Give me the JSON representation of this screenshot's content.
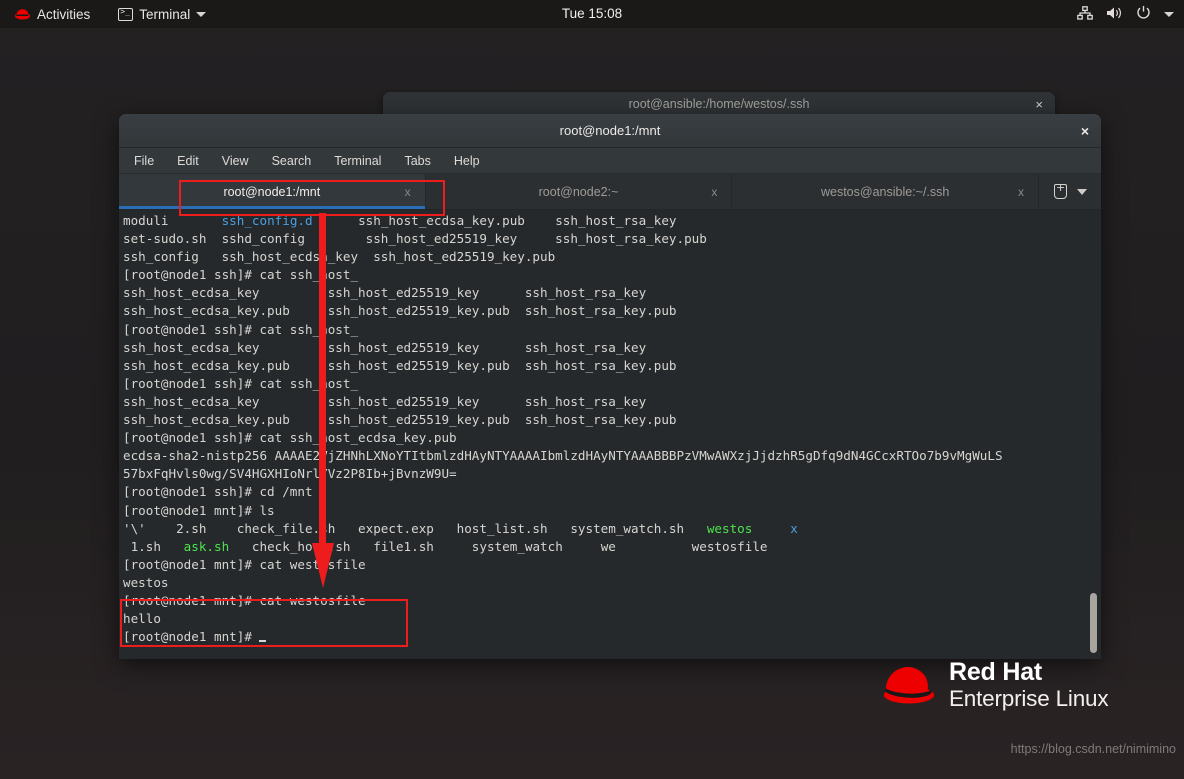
{
  "topbar": {
    "activities": "Activities",
    "app_menu": "Terminal",
    "clock": "Tue 15:08",
    "icons": [
      "network-icon",
      "volume-icon",
      "power-icon",
      "chevron-down-icon"
    ]
  },
  "background_window": {
    "title": "root@ansible:/home/westos/.ssh",
    "close": "×"
  },
  "window": {
    "title": "root@node1:/mnt",
    "close": "×"
  },
  "menubar": {
    "items": [
      "File",
      "Edit",
      "View",
      "Search",
      "Terminal",
      "Tabs",
      "Help"
    ]
  },
  "tabs": [
    {
      "label": "root@node1:/mnt",
      "close": "x",
      "active": true
    },
    {
      "label": "root@node2:~",
      "close": "x",
      "active": false
    },
    {
      "label": "westos@ansible:~/.ssh",
      "close": "x",
      "active": false
    }
  ],
  "tab_tools": {
    "new_tab": "new-tab-icon",
    "menu": "chevron-down-icon"
  },
  "terminal": {
    "lines": [
      [
        {
          "t": "moduli       "
        },
        {
          "t": "ssh_config.d",
          "c": "b"
        },
        {
          "t": "      ssh_host_ecdsa_key.pub    ssh_host_rsa_key"
        }
      ],
      [
        {
          "t": "set-sudo.sh  sshd_config        ssh_host_ed25519_key     ssh_host_rsa_key.pub"
        }
      ],
      [
        {
          "t": "ssh_config   ssh_host_ecdsa_key  ssh_host_ed25519_key.pub"
        }
      ],
      [
        {
          "t": "[root@node1 ssh]# cat ssh_host_"
        }
      ],
      [
        {
          "t": "ssh_host_ecdsa_key         ssh_host_ed25519_key      ssh_host_rsa_key"
        }
      ],
      [
        {
          "t": "ssh_host_ecdsa_key.pub     ssh_host_ed25519_key.pub  ssh_host_rsa_key.pub"
        }
      ],
      [
        {
          "t": "[root@node1 ssh]# cat ssh_host_"
        }
      ],
      [
        {
          "t": "ssh_host_ecdsa_key         ssh_host_ed25519_key      ssh_host_rsa_key"
        }
      ],
      [
        {
          "t": "ssh_host_ecdsa_key.pub     ssh_host_ed25519_key.pub  ssh_host_rsa_key.pub"
        }
      ],
      [
        {
          "t": "[root@node1 ssh]# cat ssh_host_"
        }
      ],
      [
        {
          "t": "ssh_host_ecdsa_key         ssh_host_ed25519_key      ssh_host_rsa_key"
        }
      ],
      [
        {
          "t": "ssh_host_ecdsa_key.pub     ssh_host_ed25519_key.pub  ssh_host_rsa_key.pub"
        }
      ],
      [
        {
          "t": "[root@node1 ssh]# cat ssh_host_ecdsa_key.pub"
        }
      ],
      [
        {
          "t": "ecdsa-sha2-nistp256 AAAAE2VjZHNhLXNoYTItbmlzdHAyNTYAAAAIbmlzdHAyNTYAAABBBPzVMwAWXzjJjdzhR5gDfq9dN4GCcxRTOo7b9vMgWuLS"
        }
      ],
      [
        {
          "t": "57bxFqHvls0wg/SV4HGXHIoNrlYVz2P8Ib+jBvnzW9U="
        }
      ],
      [
        {
          "t": "[root@node1 ssh]# cd /mnt"
        }
      ],
      [
        {
          "t": "[root@node1 mnt]# ls"
        }
      ],
      [
        {
          "t": "'\\'    2.sh    check_file.sh   expect.exp   host_list.sh   system_watch.sh   "
        },
        {
          "t": "westos",
          "c": "g"
        },
        {
          "t": "     "
        },
        {
          "t": "x",
          "c": "b"
        }
      ],
      [
        {
          "t": " 1.sh   "
        },
        {
          "t": "ask.sh",
          "c": "g"
        },
        {
          "t": "   check_host.sh   file1.sh     system_watch     we          westosfile"
        }
      ],
      [
        {
          "t": "[root@node1 mnt]# cat westosfile"
        }
      ],
      [
        {
          "t": "westos"
        }
      ],
      [
        {
          "t": "[root@node1 mnt]# cat westosfile"
        }
      ],
      [
        {
          "t": "hello"
        }
      ],
      [
        {
          "t": "[root@node1 mnt]# "
        },
        {
          "t": "",
          "cursor": true
        }
      ]
    ]
  },
  "branding": {
    "line1": "Red Hat",
    "line2": "Enterprise Linux",
    "logo": "redhat-fedora-logo",
    "color": "#ee0000"
  },
  "watermark": {
    "text": "https://blog.csdn.net/nimimino"
  },
  "annotations": {
    "tab_highlight": "red-box-around-active-tab",
    "command_highlight": "red-box-around-cat-westosfile-output",
    "arrow": "red-down-arrow"
  }
}
